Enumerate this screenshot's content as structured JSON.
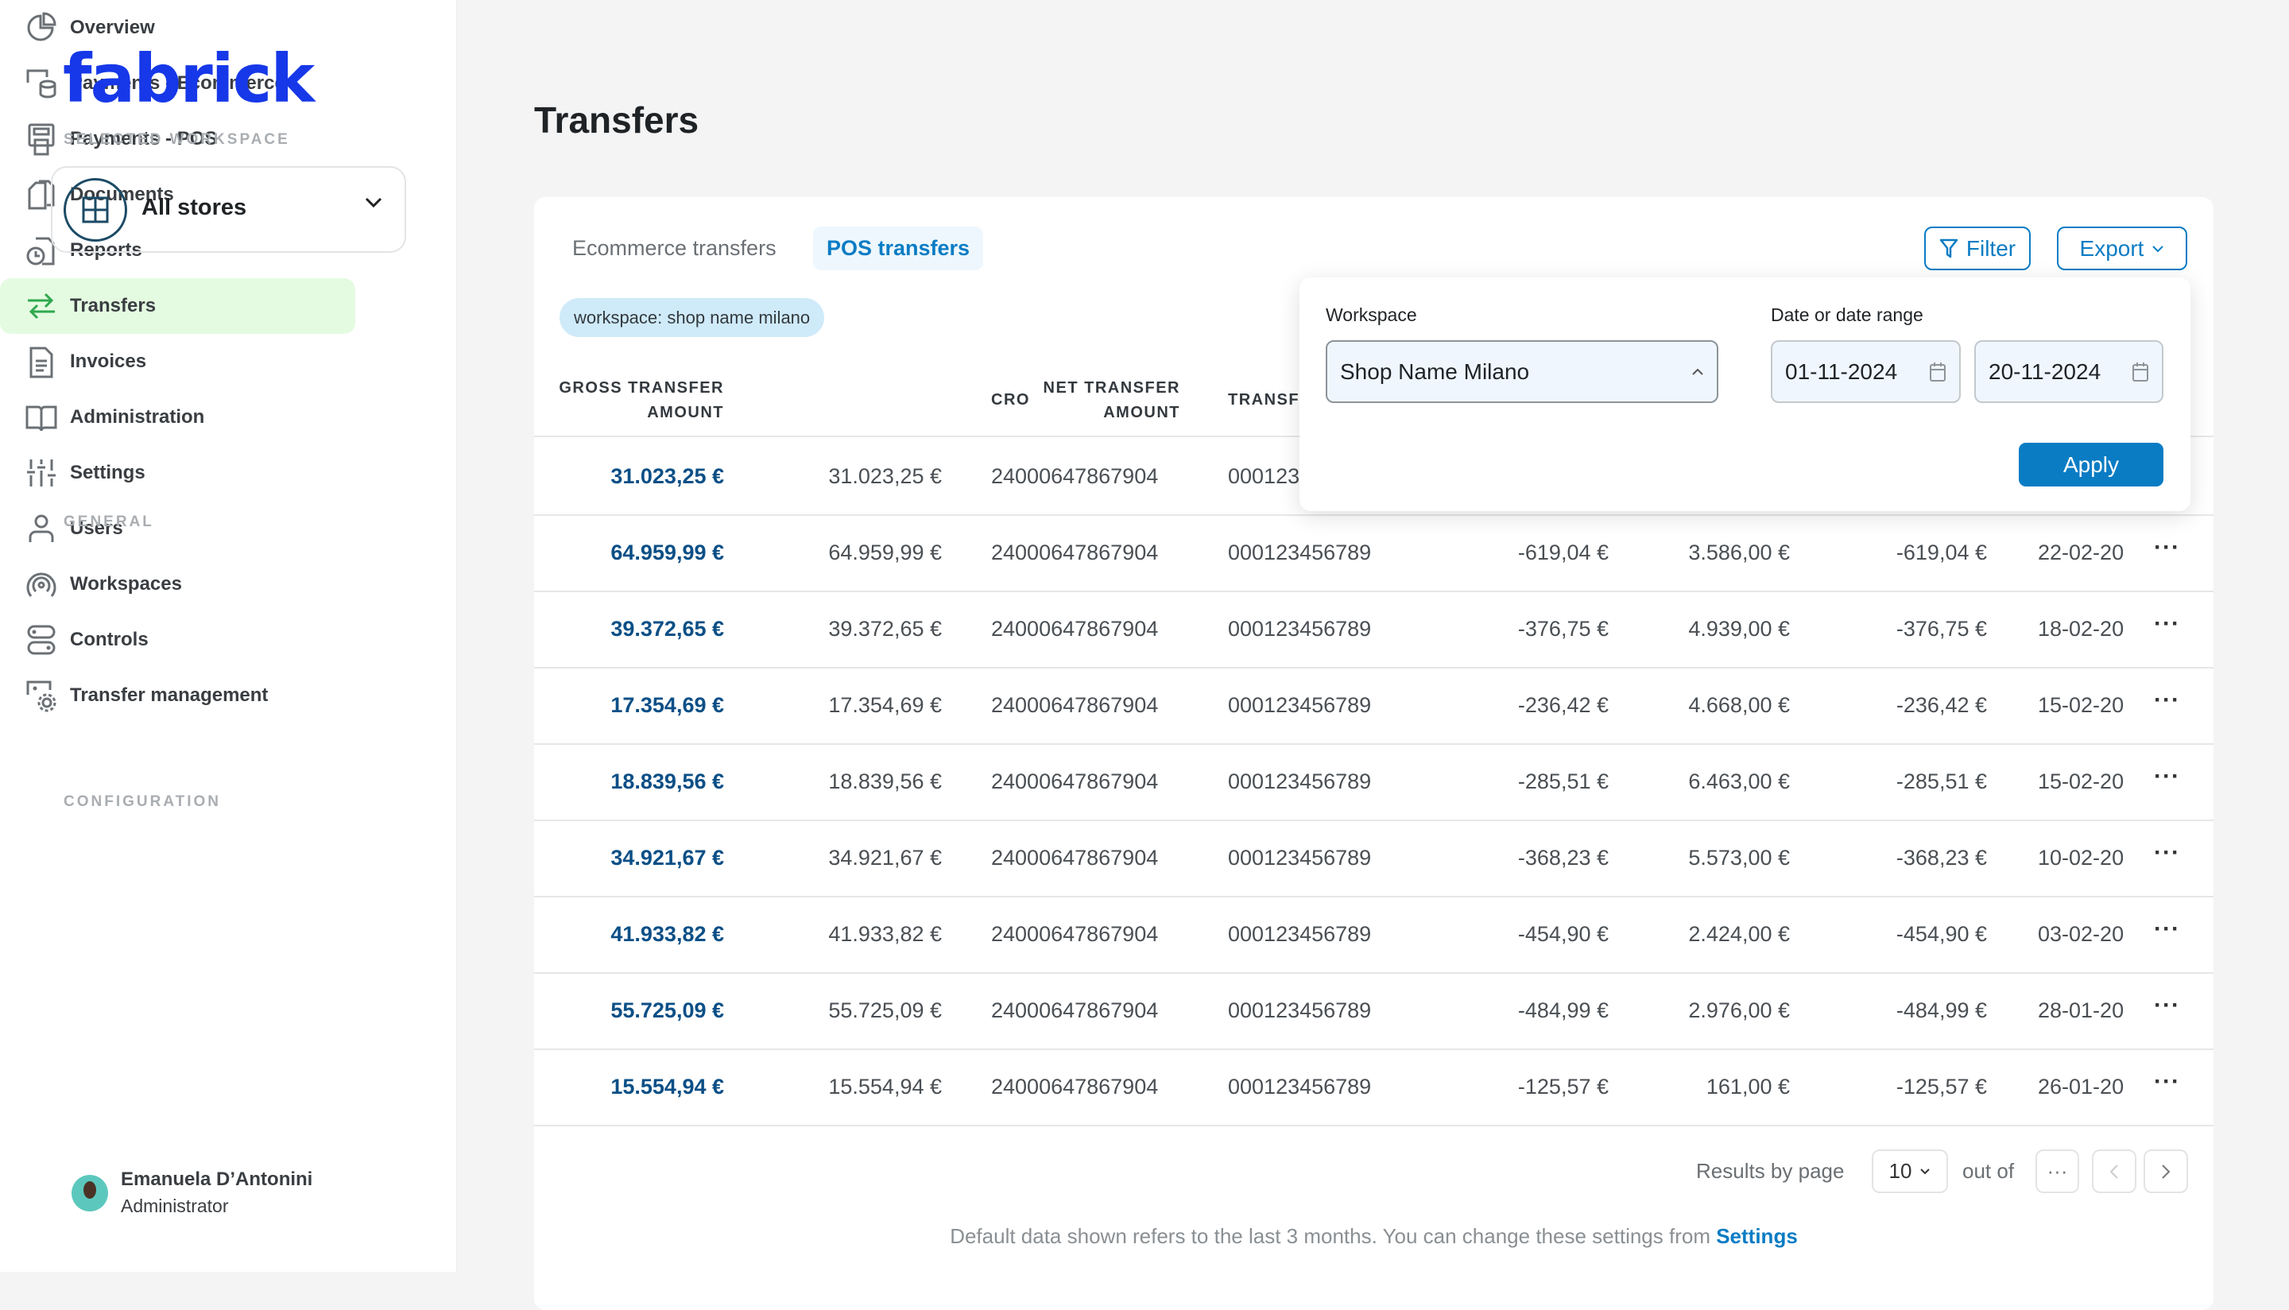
{
  "brand": {
    "logo": "fabrick",
    "accent": "#1638e8"
  },
  "sidebar": {
    "selected_workspace_label": "SELECTED WORKSPACE",
    "workspace": "All stores",
    "sections": {
      "general": "GENERAL",
      "configuration": "CONFIGURATION"
    },
    "items": [
      {
        "label": "Overview",
        "icon": "pie-chart-icon"
      },
      {
        "label": "Payments - Ecommerce",
        "icon": "payments-ecommerce-icon"
      },
      {
        "label": "Payments - POS",
        "icon": "pos-terminal-icon"
      },
      {
        "label": "Documents",
        "icon": "documents-icon"
      },
      {
        "label": "Reports",
        "icon": "reports-icon"
      },
      {
        "label": "Transfers",
        "icon": "transfer-arrows-icon",
        "active": true
      },
      {
        "label": "Invoices",
        "icon": "invoice-icon"
      },
      {
        "label": "Administration",
        "icon": "book-icon"
      },
      {
        "label": "Settings",
        "icon": "sliders-icon"
      },
      {
        "label": "Users",
        "icon": "user-icon"
      },
      {
        "label": "Workspaces",
        "icon": "broadcast-icon"
      },
      {
        "label": "Controls",
        "icon": "toggles-icon"
      },
      {
        "label": "Transfer management",
        "icon": "transfer-gear-icon"
      }
    ],
    "user": {
      "name": "Emanuela D’Antonini",
      "role": "Administrator"
    }
  },
  "page": {
    "title": "Transfers"
  },
  "tabs": [
    {
      "label": "Ecommerce transfers"
    },
    {
      "label": "POS transfers",
      "active": true
    }
  ],
  "toolbar": {
    "filter": "Filter",
    "export": "Export"
  },
  "chip": "workspace: shop name milano",
  "table": {
    "headers": [
      [
        "GROSS TRANSFER",
        "AMOUNT"
      ],
      [
        "NET TRANSFER",
        "AMOUNT"
      ],
      [
        "CRO"
      ],
      [
        "TRANSF"
      ]
    ],
    "rows": [
      [
        "31.023,25 €",
        "31.023,25 €",
        "24000647867904",
        "000123",
        "",
        "",
        "",
        ""
      ],
      [
        "64.959,99 €",
        "64.959,99 €",
        "24000647867904",
        "000123456789",
        "-619,04 €",
        "3.586,00 €",
        "-619,04 €",
        "22-02-20"
      ],
      [
        "39.372,65 €",
        "39.372,65 €",
        "24000647867904",
        "000123456789",
        "-376,75 €",
        "4.939,00 €",
        "-376,75 €",
        "18-02-20"
      ],
      [
        "17.354,69 €",
        "17.354,69 €",
        "24000647867904",
        "000123456789",
        "-236,42 €",
        "4.668,00 €",
        "-236,42 €",
        "15-02-20"
      ],
      [
        "18.839,56 €",
        "18.839,56 €",
        "24000647867904",
        "000123456789",
        "-285,51 €",
        "6.463,00 €",
        "-285,51 €",
        "15-02-20"
      ],
      [
        "34.921,67 €",
        "34.921,67 €",
        "24000647867904",
        "000123456789",
        "-368,23 €",
        "5.573,00 €",
        "-368,23 €",
        "10-02-20"
      ],
      [
        "41.933,82 €",
        "41.933,82 €",
        "24000647867904",
        "000123456789",
        "-454,90 €",
        "2.424,00 €",
        "-454,90 €",
        "03-02-20"
      ],
      [
        "55.725,09 €",
        "55.725,09 €",
        "24000647867904",
        "000123456789",
        "-484,99 €",
        "2.976,00 €",
        "-484,99 €",
        "28-01-20"
      ],
      [
        "15.554,94 €",
        "15.554,94 €",
        "24000647867904",
        "000123456789",
        "-125,57 €",
        "161,00 €",
        "-125,57 €",
        "26-01-20"
      ]
    ]
  },
  "filter_popup": {
    "workspace_label": "Workspace",
    "workspace_value": "Shop Name Milano",
    "date_label": "Date or date range",
    "date_from": "01-11-2024",
    "date_to": "20-11-2024",
    "apply": "Apply"
  },
  "pagination": {
    "results_label": "Results by page",
    "page_size": "10",
    "out_of": "out of",
    "total": "···"
  },
  "footer": {
    "text": "Default data shown refers to the last 3 months. You can change these settings from ",
    "link": "Settings"
  }
}
